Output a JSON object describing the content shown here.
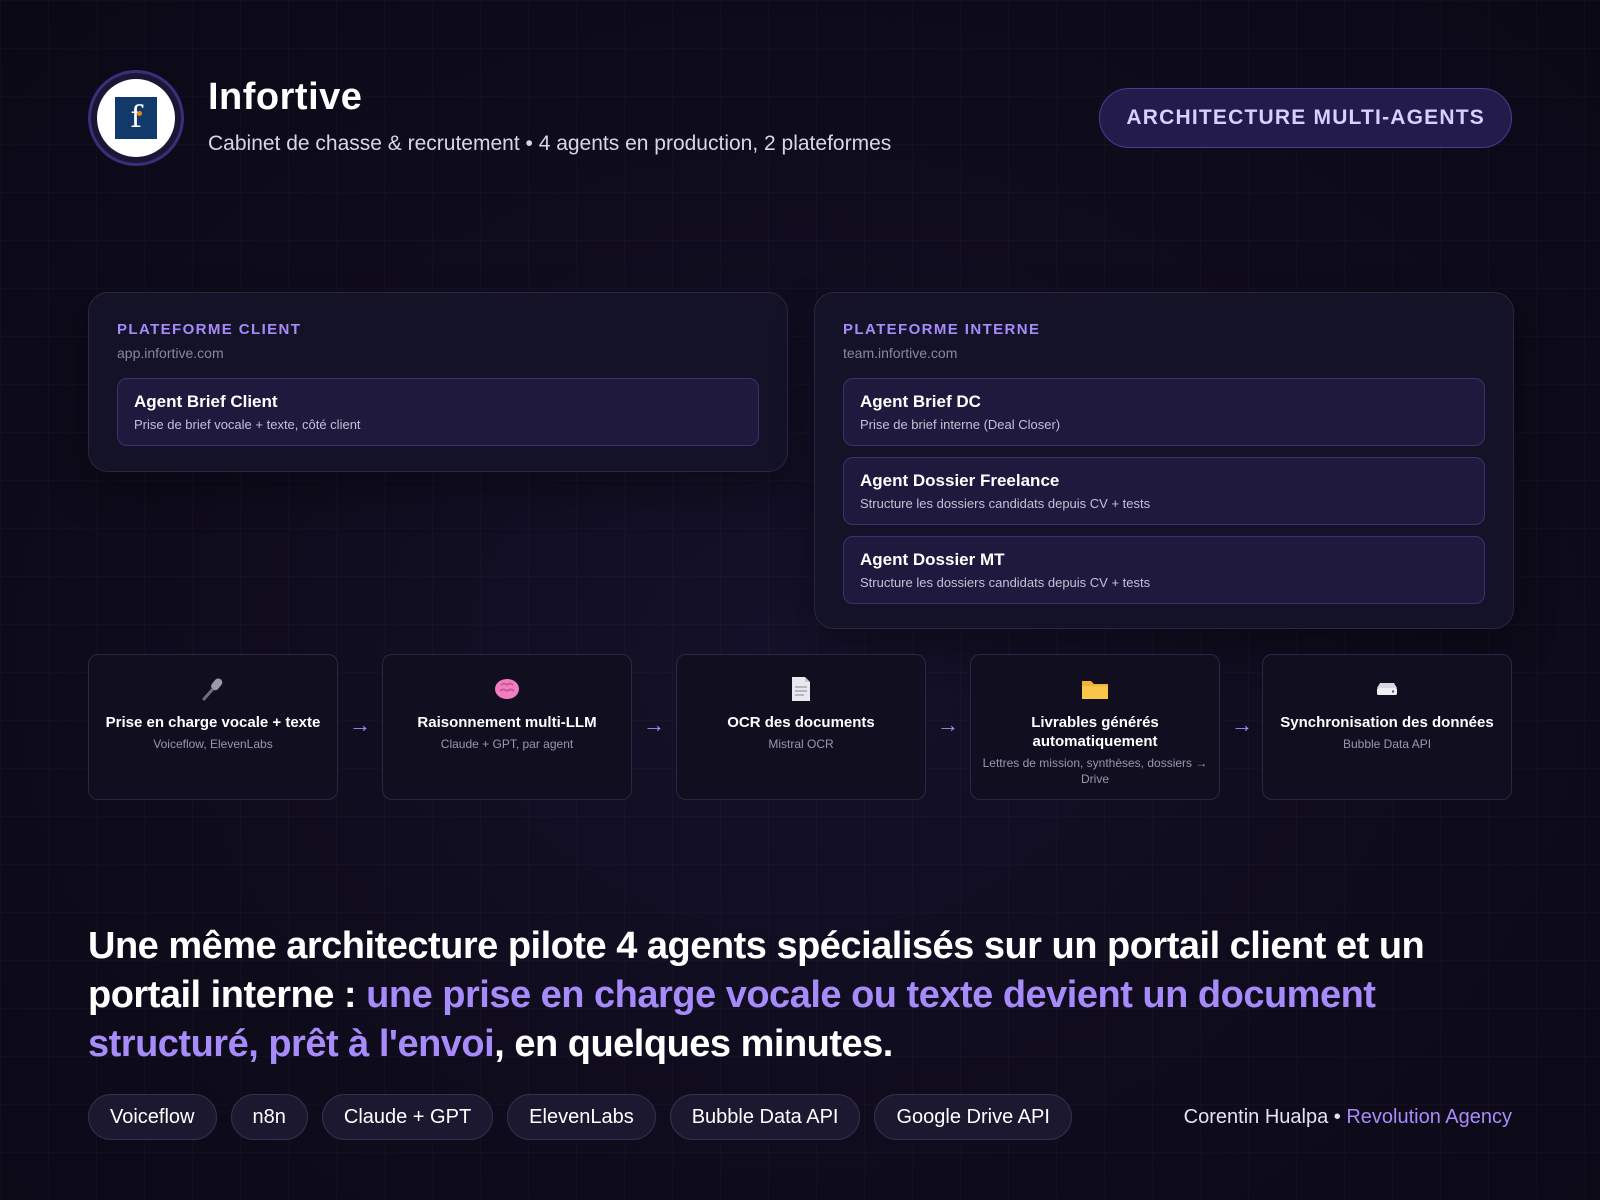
{
  "header": {
    "logo_letter": "f",
    "title": "Infortive",
    "subtitle": "Cabinet de chasse & recrutement • 4 agents en production, 2 plateformes",
    "badge": "ARCHITECTURE MULTI-AGENTS"
  },
  "platforms": {
    "client": {
      "label": "PLATEFORME CLIENT",
      "url": "app.infortive.com",
      "agents": [
        {
          "name": "Agent Brief Client",
          "desc": "Prise de brief vocale + texte, côté client"
        }
      ]
    },
    "interne": {
      "label": "PLATEFORME INTERNE",
      "url": "team.infortive.com",
      "agents": [
        {
          "name": "Agent Brief DC",
          "desc": "Prise de brief interne (Deal Closer)"
        },
        {
          "name": "Agent Dossier Freelance",
          "desc": "Structure les dossiers candidats depuis CV + tests"
        },
        {
          "name": "Agent Dossier MT",
          "desc": "Structure les dossiers candidats depuis CV + tests"
        }
      ]
    }
  },
  "pipeline": {
    "steps": [
      {
        "icon": "microphone-icon",
        "title": "Prise en charge vocale + texte",
        "tools": "Voiceflow, ElevenLabs"
      },
      {
        "icon": "brain-icon",
        "title": "Raisonnement multi-LLM",
        "tools": "Claude + GPT, par agent"
      },
      {
        "icon": "document-icon",
        "title": "OCR des documents",
        "tools": "Mistral OCR"
      },
      {
        "icon": "folder-icon",
        "title": "Livrables générés automatiquement",
        "tools": "Lettres de mission, synthèses, dossiers → Drive"
      },
      {
        "icon": "database-icon",
        "title": "Synchronisation des données",
        "tools": "Bubble Data API"
      }
    ],
    "arrow": "→"
  },
  "headline": {
    "part1": "Une même architecture pilote 4 agents spécialisés sur un portail client et un portail interne : ",
    "highlight": "une prise en charge vocale ou texte devient un document structuré, prêt à l'envoi",
    "part2": ", en quelques minutes."
  },
  "tags": [
    "Voiceflow",
    "n8n",
    "Claude + GPT",
    "ElevenLabs",
    "Bubble Data API",
    "Google Drive API"
  ],
  "credit": {
    "author": "Corentin Hualpa",
    "separator": " • ",
    "agency": "Revolution Agency"
  },
  "colors": {
    "background": "#0e0b1b",
    "accent": "#a78bfa",
    "card": "#141226",
    "agent_card": "#1f1a3d",
    "logo_square": "#113a6b"
  }
}
